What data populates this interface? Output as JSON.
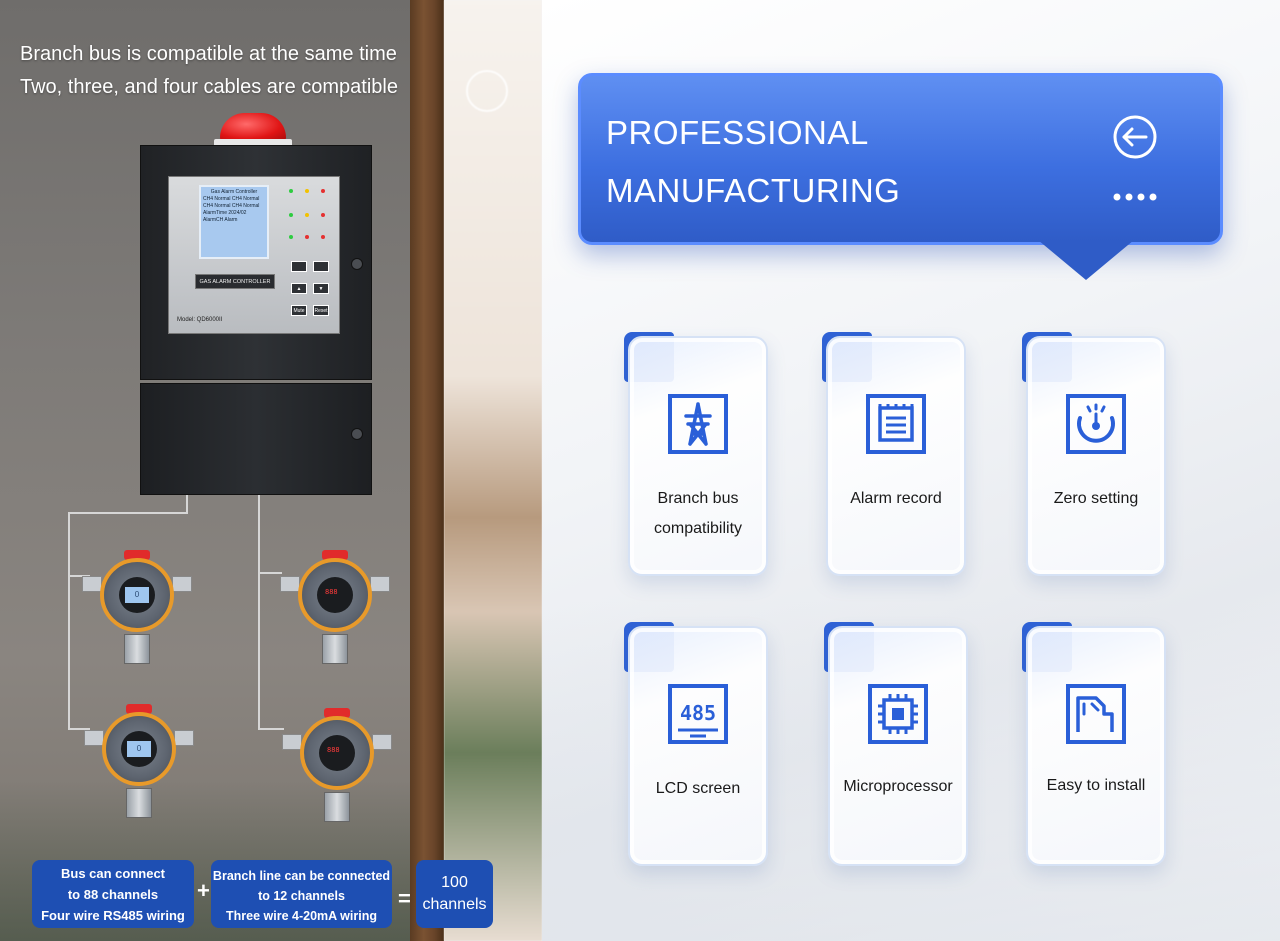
{
  "left": {
    "headline_line1": "Branch bus is compatible at the same time",
    "headline_line2": "Two, three, and four cables are compatible"
  },
  "controller": {
    "lcd_title": "Gas Alarm Controller",
    "lcd_rows": [
      "CH4  Normal  CH4  Normal",
      "CH4  Normal  CH4  Normal",
      "AlarmTime 2024/02  AlarmCH  Alarm"
    ],
    "label": "GAS ALARM CONTROLLER",
    "model": "Model: QD6000II",
    "btn_mute": "Mute",
    "btn_reset": "Reset"
  },
  "sensors": [
    {
      "display": "0"
    },
    {
      "display": "888"
    },
    {
      "display": "0"
    },
    {
      "display": "888"
    }
  ],
  "formula": {
    "box1_line1": "Bus can connect",
    "box1_line2": "to 88 channels",
    "box1_line3": "Four wire RS485 wiring",
    "plus": "+",
    "box2_line1": "Branch line can be connected",
    "box2_line2": "to 12 channels",
    "box2_line3": "Three wire 4-20mA wiring",
    "equals": "=",
    "box3_line1": "100",
    "box3_line2": "channels"
  },
  "banner": {
    "title_line1": "PROFESSIONAL",
    "title_line2": "MANUFACTURING"
  },
  "features": [
    {
      "icon": "tower-icon",
      "label_line1": "Branch bus",
      "label_line2": "compatibility"
    },
    {
      "icon": "record-icon",
      "label_line1": "Alarm record",
      "label_line2": ""
    },
    {
      "icon": "gauge-icon",
      "label_line1": "Zero setting",
      "label_line2": ""
    },
    {
      "icon": "lcd-485-icon",
      "label_line1": "LCD screen",
      "label_line2": ""
    },
    {
      "icon": "chip-icon",
      "label_line1": "Microprocessor",
      "label_line2": ""
    },
    {
      "icon": "install-icon",
      "label_line1": "Easy to install",
      "label_line2": ""
    }
  ],
  "colors": {
    "accent": "#2f62d6",
    "formula_box": "#1e4fb3",
    "icon_blue": "#2a5fd8"
  }
}
